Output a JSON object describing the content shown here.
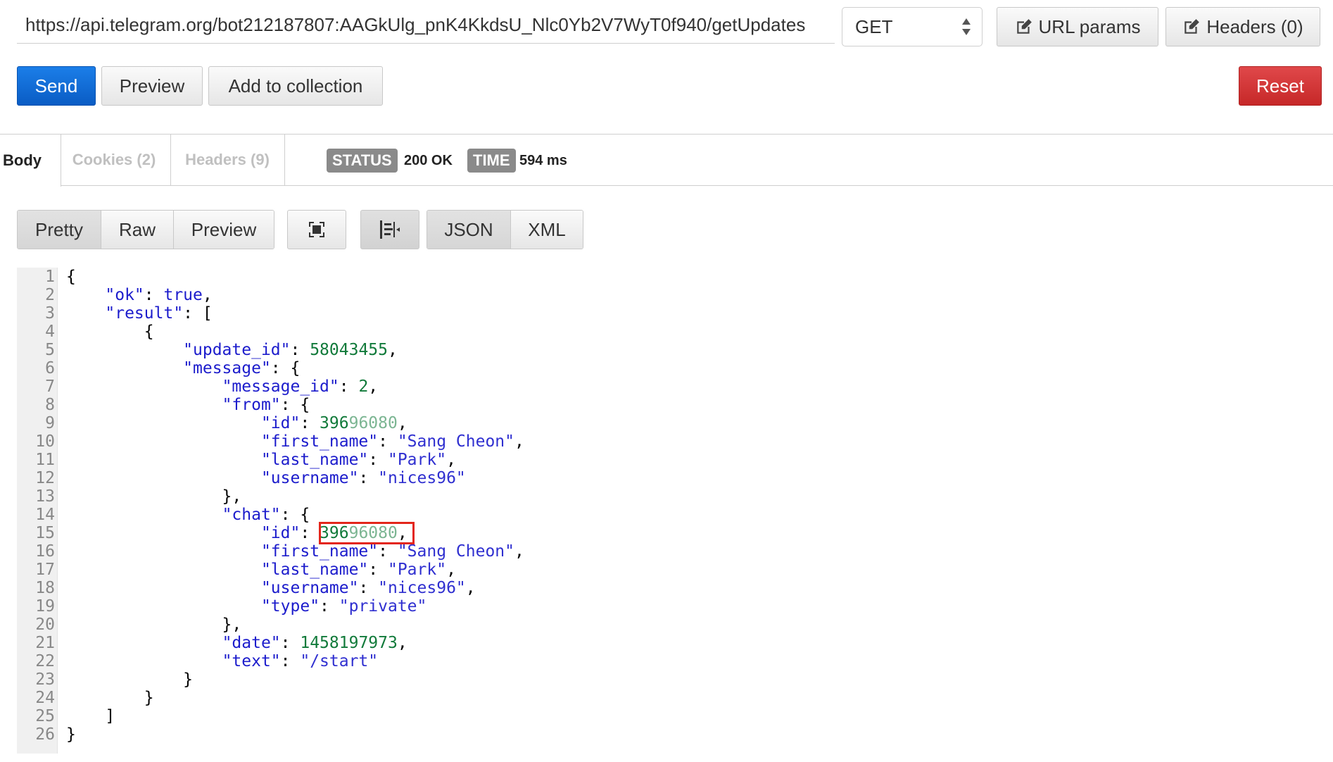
{
  "request": {
    "url": "https://api.telegram.org/bot212187807:AAGkUlg_pnK4KkdsU_Nlc0Yb2V7WyT0f940/getUpdates",
    "method": "GET",
    "url_params_label": "URL params",
    "headers_label": "Headers (0)"
  },
  "actions": {
    "send": "Send",
    "preview": "Preview",
    "add_to_collection": "Add to collection",
    "reset": "Reset"
  },
  "response": {
    "tabs": [
      {
        "label": "Body"
      },
      {
        "label": "Cookies (2)"
      },
      {
        "label": "Headers (9)"
      }
    ],
    "status_label": "STATUS",
    "status_value": "200 OK",
    "time_label": "TIME",
    "time_value": "594 ms"
  },
  "view": {
    "modes": [
      "Pretty",
      "Raw",
      "Preview"
    ],
    "formats": [
      "JSON",
      "XML"
    ],
    "icons": [
      "expand-icon",
      "wrap-lines-icon"
    ]
  },
  "code": {
    "lines": [
      {
        "n": "1",
        "parts": [
          [
            "tx",
            "{"
          ]
        ]
      },
      {
        "n": "2",
        "parts": [
          [
            "tx",
            "    "
          ],
          [
            "k",
            "\"ok\""
          ],
          [
            "tx",
            ": "
          ],
          [
            "b",
            "true"
          ],
          [
            "tx",
            ","
          ]
        ]
      },
      {
        "n": "3",
        "parts": [
          [
            "tx",
            "    "
          ],
          [
            "k",
            "\"result\""
          ],
          [
            "tx",
            ": ["
          ]
        ]
      },
      {
        "n": "4",
        "parts": [
          [
            "tx",
            "        {"
          ]
        ]
      },
      {
        "n": "5",
        "parts": [
          [
            "tx",
            "            "
          ],
          [
            "k",
            "\"update_id\""
          ],
          [
            "tx",
            ": "
          ],
          [
            "n",
            "58043455"
          ],
          [
            "tx",
            ","
          ]
        ]
      },
      {
        "n": "6",
        "parts": [
          [
            "tx",
            "            "
          ],
          [
            "k",
            "\"message\""
          ],
          [
            "tx",
            ": {"
          ]
        ]
      },
      {
        "n": "7",
        "parts": [
          [
            "tx",
            "                "
          ],
          [
            "k",
            "\"message_id\""
          ],
          [
            "tx",
            ": "
          ],
          [
            "n",
            "2"
          ],
          [
            "tx",
            ","
          ]
        ]
      },
      {
        "n": "8",
        "parts": [
          [
            "tx",
            "                "
          ],
          [
            "k",
            "\"from\""
          ],
          [
            "tx",
            ": {"
          ]
        ]
      },
      {
        "n": "9",
        "parts": [
          [
            "tx",
            "                    "
          ],
          [
            "k",
            "\"id\""
          ],
          [
            "tx",
            ": "
          ],
          [
            "n",
            "396"
          ],
          [
            "fade",
            "96080"
          ],
          [
            "tx",
            ","
          ]
        ]
      },
      {
        "n": "10",
        "parts": [
          [
            "tx",
            "                    "
          ],
          [
            "k",
            "\"first_name\""
          ],
          [
            "tx",
            ": "
          ],
          [
            "v",
            "\"Sang Cheon\""
          ],
          [
            "tx",
            ","
          ]
        ]
      },
      {
        "n": "11",
        "parts": [
          [
            "tx",
            "                    "
          ],
          [
            "k",
            "\"last_name\""
          ],
          [
            "tx",
            ": "
          ],
          [
            "v",
            "\"Park\""
          ],
          [
            "tx",
            ","
          ]
        ]
      },
      {
        "n": "12",
        "parts": [
          [
            "tx",
            "                    "
          ],
          [
            "k",
            "\"username\""
          ],
          [
            "tx",
            ": "
          ],
          [
            "v",
            "\"nices96\""
          ]
        ]
      },
      {
        "n": "13",
        "parts": [
          [
            "tx",
            "                },"
          ]
        ]
      },
      {
        "n": "14",
        "parts": [
          [
            "tx",
            "                "
          ],
          [
            "k",
            "\"chat\""
          ],
          [
            "tx",
            ": {"
          ]
        ]
      },
      {
        "n": "15",
        "parts": [
          [
            "tx",
            "                    "
          ],
          [
            "k",
            "\"id\""
          ],
          [
            "tx",
            ": "
          ],
          [
            "n",
            "396"
          ],
          [
            "fade",
            "96080"
          ],
          [
            "tx",
            ","
          ]
        ]
      },
      {
        "n": "16",
        "parts": [
          [
            "tx",
            "                    "
          ],
          [
            "k",
            "\"first_name\""
          ],
          [
            "tx",
            ": "
          ],
          [
            "v",
            "\"Sang Cheon\""
          ],
          [
            "tx",
            ","
          ]
        ]
      },
      {
        "n": "17",
        "parts": [
          [
            "tx",
            "                    "
          ],
          [
            "k",
            "\"last_name\""
          ],
          [
            "tx",
            ": "
          ],
          [
            "v",
            "\"Park\""
          ],
          [
            "tx",
            ","
          ]
        ]
      },
      {
        "n": "18",
        "parts": [
          [
            "tx",
            "                    "
          ],
          [
            "k",
            "\"username\""
          ],
          [
            "tx",
            ": "
          ],
          [
            "v",
            "\"nices96\""
          ],
          [
            "tx",
            ","
          ]
        ]
      },
      {
        "n": "19",
        "parts": [
          [
            "tx",
            "                    "
          ],
          [
            "k",
            "\"type\""
          ],
          [
            "tx",
            ": "
          ],
          [
            "v",
            "\"private\""
          ]
        ]
      },
      {
        "n": "20",
        "parts": [
          [
            "tx",
            "                },"
          ]
        ]
      },
      {
        "n": "21",
        "parts": [
          [
            "tx",
            "                "
          ],
          [
            "k",
            "\"date\""
          ],
          [
            "tx",
            ": "
          ],
          [
            "n",
            "1458197973"
          ],
          [
            "tx",
            ","
          ]
        ]
      },
      {
        "n": "22",
        "parts": [
          [
            "tx",
            "                "
          ],
          [
            "k",
            "\"text\""
          ],
          [
            "tx",
            ": "
          ],
          [
            "v",
            "\"/start\""
          ]
        ]
      },
      {
        "n": "23",
        "parts": [
          [
            "tx",
            "            }"
          ]
        ]
      },
      {
        "n": "24",
        "parts": [
          [
            "tx",
            "        }"
          ]
        ]
      },
      {
        "n": "25",
        "parts": [
          [
            "tx",
            "    ]"
          ]
        ]
      },
      {
        "n": "26",
        "parts": [
          [
            "tx",
            "}"
          ]
        ]
      }
    ]
  },
  "colors": {
    "send": "#0a5cc4",
    "reset": "#c62828",
    "highlight": "#e3261b",
    "key": "#1c1ccc",
    "number": "#117a3a"
  }
}
